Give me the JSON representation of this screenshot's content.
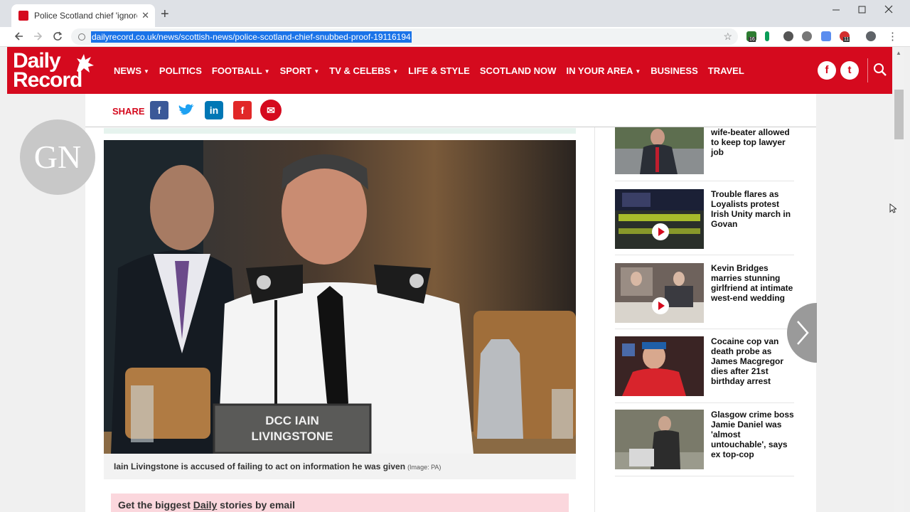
{
  "browser": {
    "tab_title": "Police Scotland chief 'ignored pr",
    "tab_close": "✕",
    "new_tab": "+",
    "url": "dailyrecord.co.uk/news/scottish-news/police-scotland-chief-snubbed-proof-19116194",
    "extension_badges": [
      "16",
      "11"
    ]
  },
  "site": {
    "logo_line1": "Daily",
    "logo_line2": "Record",
    "nav": [
      {
        "label": "NEWS",
        "caret": true
      },
      {
        "label": "POLITICS",
        "caret": false
      },
      {
        "label": "FOOTBALL",
        "caret": true
      },
      {
        "label": "SPORT",
        "caret": true
      },
      {
        "label": "TV & CELEBS",
        "caret": true
      },
      {
        "label": "LIFE & STYLE",
        "caret": false
      },
      {
        "label": "SCOTLAND NOW",
        "caret": false
      },
      {
        "label": "IN YOUR AREA",
        "caret": true
      },
      {
        "label": "BUSINESS",
        "caret": false
      },
      {
        "label": "TRAVEL",
        "caret": false
      }
    ],
    "social_header": [
      "f",
      "t"
    ],
    "brand_color": "#d50a1e"
  },
  "share": {
    "label": "SHARE",
    "facebook": "f",
    "twitter": "t",
    "linkedin": "in",
    "flipboard": "f",
    "email": "✉"
  },
  "article": {
    "image_nameplate_line1": "DCC IAIN",
    "image_nameplate_line2": "LIVINGSTONE",
    "caption": "Iain Livingstone is accused of failing to act on information he was given",
    "caption_credit": "(Image: PA)",
    "signup_pre": "Get the biggest ",
    "signup_brand": "Daily",
    "signup_post": " stories by email"
  },
  "sidebar": [
    {
      "title": "wife-beater allowed to keep top lawyer job",
      "video": false
    },
    {
      "title": "Trouble flares as Loyalists protest Irish Unity march in Govan",
      "video": true
    },
    {
      "title": "Kevin Bridges marries stunning girlfriend at intimate west-end wedding",
      "video": true
    },
    {
      "title": "Cocaine cop van death probe as James Macgregor dies after 21st birthday arrest",
      "video": false
    },
    {
      "title": "Glasgow crime boss Jamie Daniel was 'almost untouchable', says ex top-cop",
      "video": false
    }
  ],
  "overlay": {
    "watermark": "GN"
  }
}
